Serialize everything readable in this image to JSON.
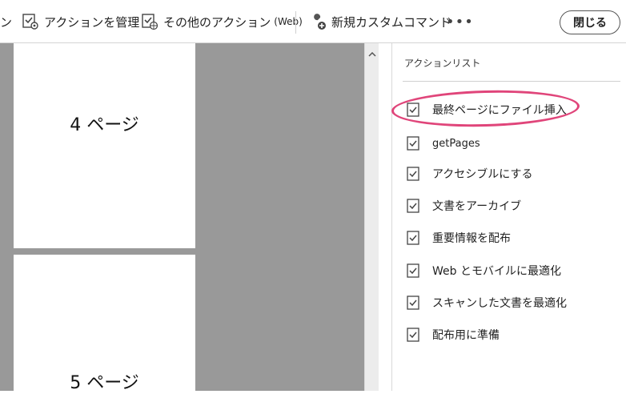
{
  "toolbar": {
    "partial_label": "ン",
    "manage_actions": "アクションを管理",
    "other_actions": "その他のアクション",
    "other_actions_suffix": "(Web)",
    "new_custom_command": "新規カスタムコマンド",
    "more": "•••",
    "close": "閉じる"
  },
  "document": {
    "pages": [
      {
        "label": "4 ページ"
      },
      {
        "label": "5 ページ"
      }
    ]
  },
  "panel": {
    "title": "アクションリスト",
    "actions": [
      {
        "label": "最終ページにファイル挿入",
        "highlighted": true
      },
      {
        "label": "getPages"
      },
      {
        "label": "アクセシブルにする"
      },
      {
        "label": "文書をアーカイブ"
      },
      {
        "label": "重要情報を配布"
      },
      {
        "label": "Web とモバイルに最適化"
      },
      {
        "label": "スキャンした文書を最適化"
      },
      {
        "label": "配布用に準備"
      }
    ]
  },
  "colors": {
    "highlight": "#e0457a",
    "doc_background": "#999999"
  }
}
